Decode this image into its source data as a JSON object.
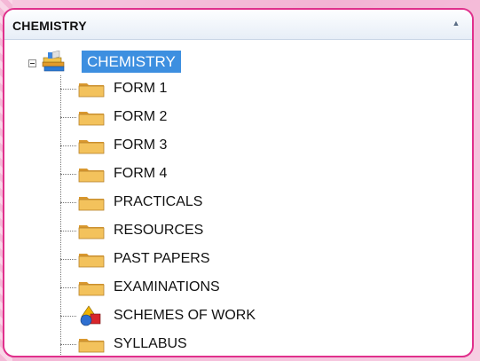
{
  "header": {
    "title": "CHEMISTRY"
  },
  "tree": {
    "root": {
      "label": "CHEMISTRY",
      "icon": "books-icon",
      "expander": "minus"
    },
    "items": [
      {
        "label": "FORM 1",
        "icon": "folder-icon"
      },
      {
        "label": "FORM 2",
        "icon": "folder-icon"
      },
      {
        "label": "FORM 3",
        "icon": "folder-icon"
      },
      {
        "label": "FORM 4",
        "icon": "folder-icon"
      },
      {
        "label": "PRACTICALS",
        "icon": "folder-icon"
      },
      {
        "label": "RESOURCES",
        "icon": "folder-icon"
      },
      {
        "label": "PAST PAPERS",
        "icon": "folder-icon"
      },
      {
        "label": "EXAMINATIONS",
        "icon": "folder-icon"
      },
      {
        "label": "SCHEMES OF WORK",
        "icon": "shapes-icon"
      },
      {
        "label": "SYLLABUS",
        "icon": "folder-icon"
      }
    ]
  },
  "colors": {
    "panel_border": "#e0308c",
    "selection": "#3d8fe0",
    "folder": "#e8b24a"
  }
}
